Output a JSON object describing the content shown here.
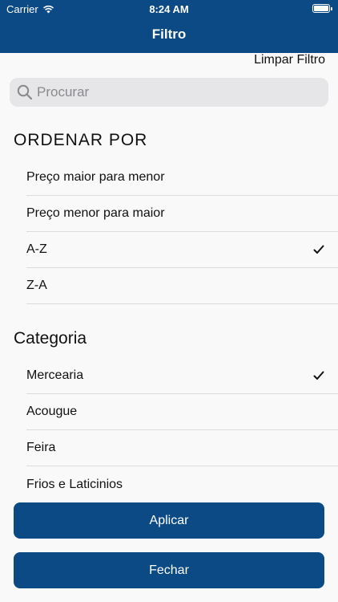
{
  "status_bar": {
    "carrier": "Carrier",
    "time": "8:24 AM"
  },
  "nav": {
    "title": "Filtro"
  },
  "actions": {
    "clear_filter": "Limpar Filtro"
  },
  "search": {
    "placeholder": "Procurar",
    "value": ""
  },
  "sort": {
    "title": "ORDENAR POR",
    "items": [
      {
        "label": "Preço maior para menor",
        "selected": false
      },
      {
        "label": "Preço menor para maior",
        "selected": false
      },
      {
        "label": "A-Z",
        "selected": true
      },
      {
        "label": "Z-A",
        "selected": false
      }
    ]
  },
  "category": {
    "title": "Categoria",
    "items": [
      {
        "label": "Mercearia",
        "selected": true
      },
      {
        "label": "Acougue",
        "selected": false
      },
      {
        "label": "Feira",
        "selected": false
      },
      {
        "label": "Frios e Laticinios",
        "selected": false
      }
    ]
  },
  "buttons": {
    "apply": "Aplicar",
    "close": "Fechar"
  },
  "colors": {
    "primary": "#0b4a84",
    "background": "#f9f9f9",
    "search_bg": "#e6e6e8",
    "separator": "#dcdcdf"
  },
  "icons": [
    "wifi-icon",
    "battery-icon",
    "search-icon",
    "checkmark-icon"
  ]
}
